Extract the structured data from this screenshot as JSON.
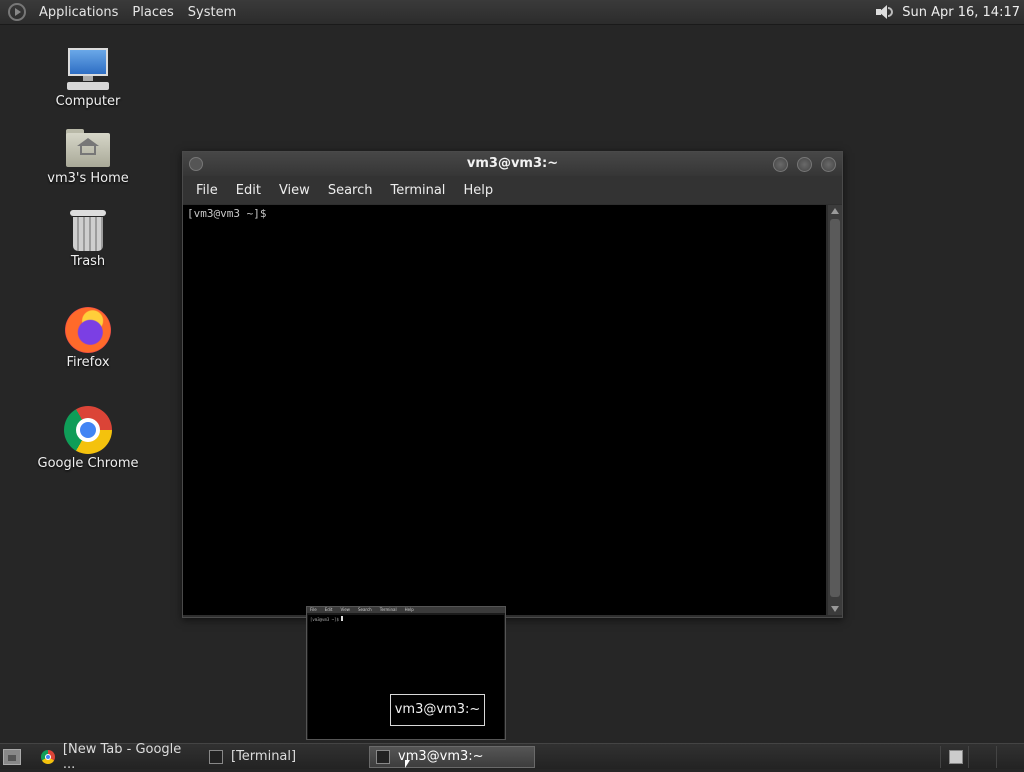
{
  "top_panel": {
    "menus": [
      "Applications",
      "Places",
      "System"
    ],
    "clock": "Sun Apr 16, 14:17"
  },
  "desktop_icons": [
    {
      "label": "Computer",
      "icon": "computer-icon"
    },
    {
      "label": "vm3's Home",
      "icon": "home-folder-icon"
    },
    {
      "label": "Trash",
      "icon": "trash-icon"
    },
    {
      "label": "Firefox",
      "icon": "firefox-icon"
    },
    {
      "label": "Google Chrome",
      "icon": "chrome-icon"
    }
  ],
  "terminal": {
    "title": "vm3@vm3:~",
    "menu": [
      "File",
      "Edit",
      "View",
      "Search",
      "Terminal",
      "Help"
    ],
    "prompt": "[vm3@vm3 ~]$"
  },
  "preview": {
    "menu": [
      "File",
      "Edit",
      "View",
      "Search",
      "Terminal",
      "Help"
    ],
    "tooltip": "vm3@vm3:~"
  },
  "taskbar": {
    "tasks": [
      {
        "label": "[New Tab - Google ...",
        "icon": "chrome-icon",
        "active": false
      },
      {
        "label": "[Terminal]",
        "icon": "terminal-icon",
        "active": false
      },
      {
        "label": "vm3@vm3:~",
        "icon": "terminal-icon",
        "active": true
      }
    ]
  }
}
